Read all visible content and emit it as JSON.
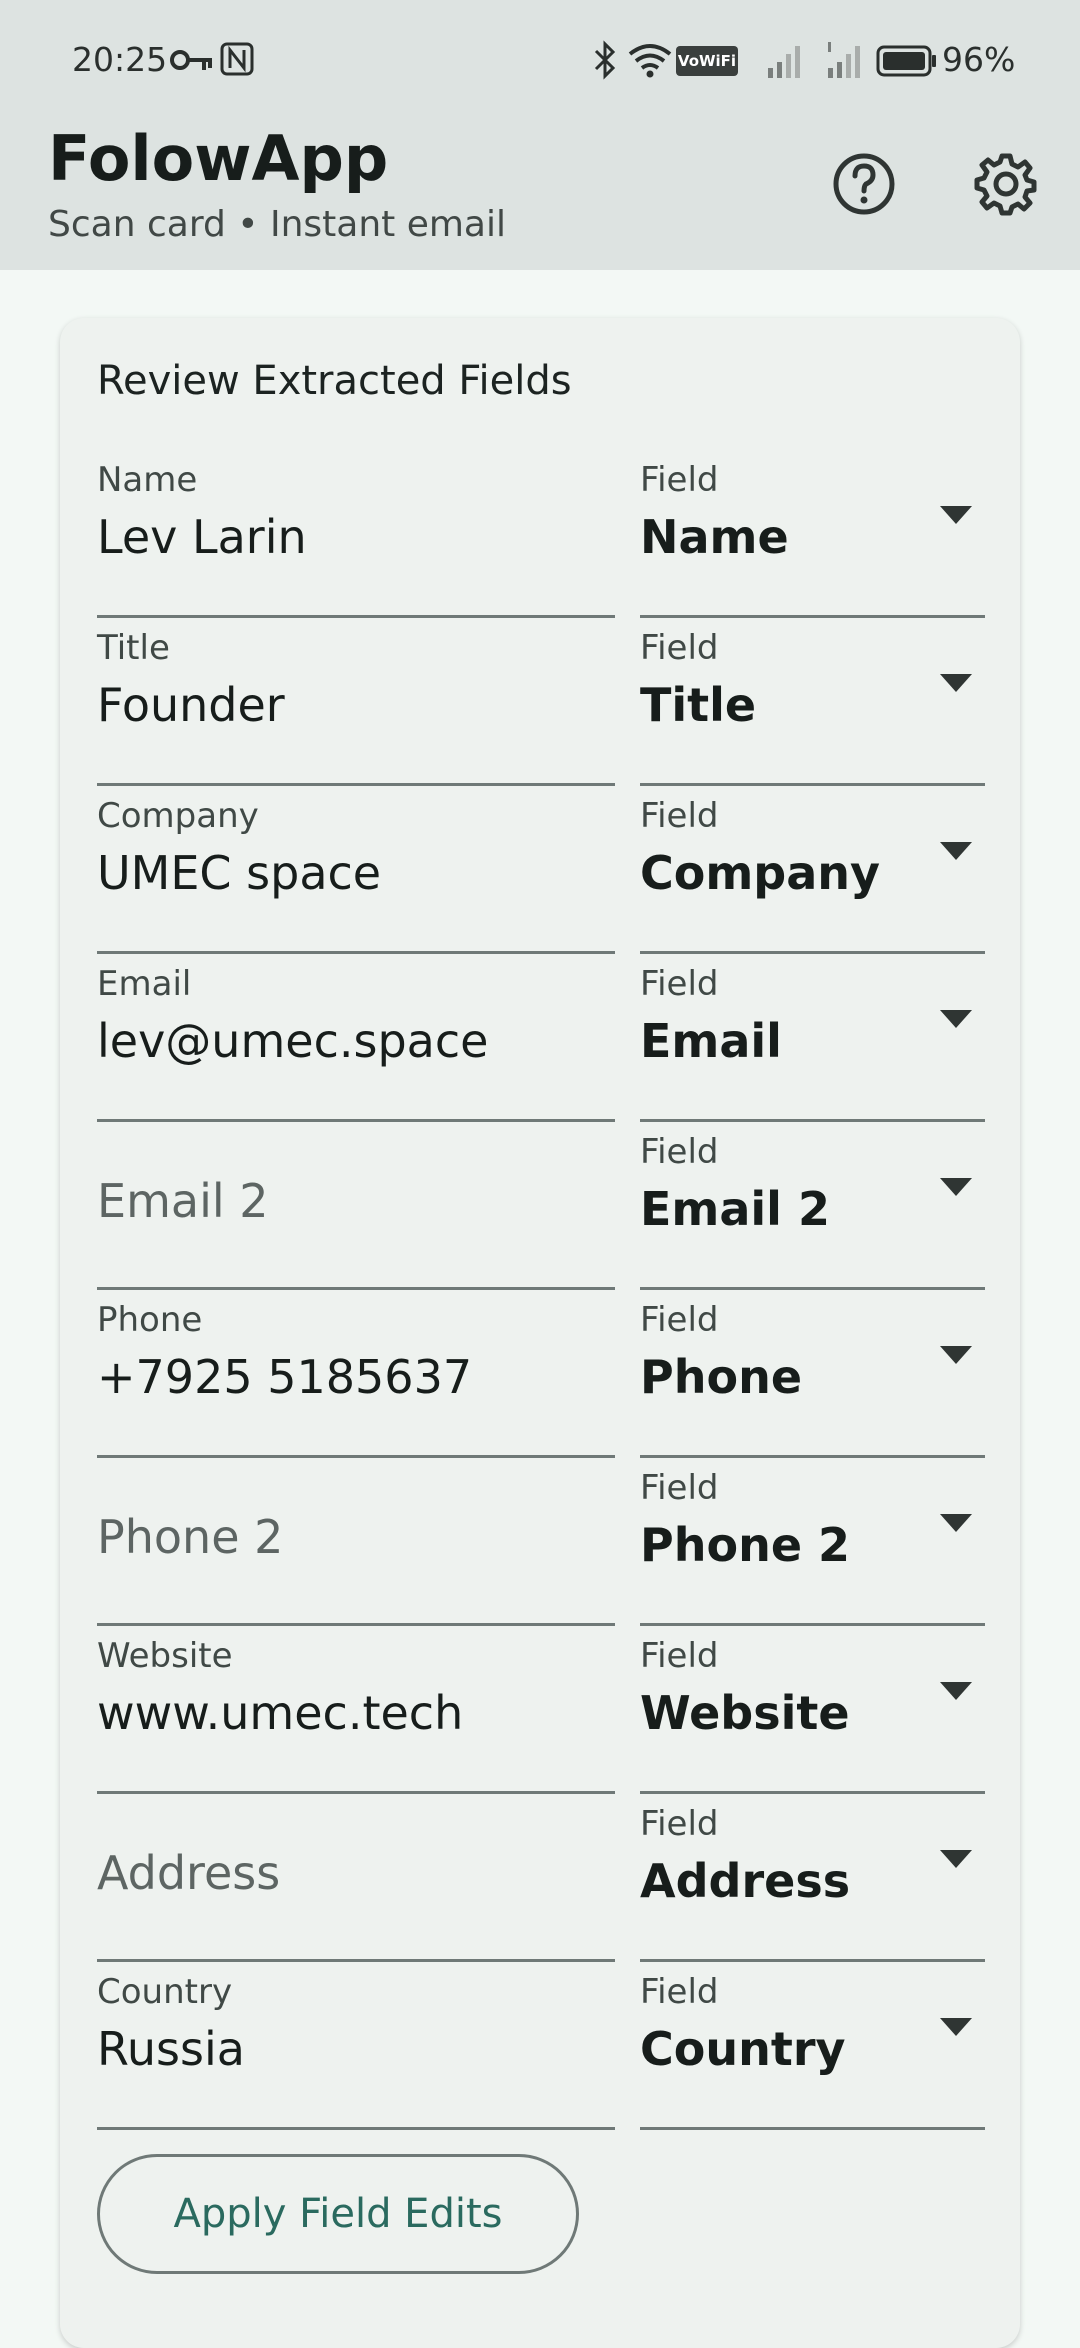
{
  "status_bar": {
    "time": "20:25",
    "vowifi": "VoWiFi",
    "battery": "96%"
  },
  "app_bar": {
    "title": "FolowApp",
    "subtitle": "Scan card • Instant email"
  },
  "card": {
    "title": "Review Extracted Fields",
    "rows": [
      {
        "label": "Name",
        "value": "Lev Larin",
        "placeholder": "",
        "field_label": "Field",
        "field_value": "Name"
      },
      {
        "label": "Title",
        "value": "Founder",
        "placeholder": "",
        "field_label": "Field",
        "field_value": "Title"
      },
      {
        "label": "Company",
        "value": "UMEC space",
        "placeholder": "",
        "field_label": "Field",
        "field_value": "Company"
      },
      {
        "label": "Email",
        "value": "lev@umec.space",
        "placeholder": "",
        "field_label": "Field",
        "field_value": "Email"
      },
      {
        "label": "",
        "value": "",
        "placeholder": "Email 2",
        "field_label": "Field",
        "field_value": "Email 2"
      },
      {
        "label": "Phone",
        "value": "+7925 5185637",
        "placeholder": "",
        "field_label": "Field",
        "field_value": "Phone"
      },
      {
        "label": "",
        "value": "",
        "placeholder": "Phone 2",
        "field_label": "Field",
        "field_value": "Phone 2"
      },
      {
        "label": "Website",
        "value": "www.umec.tech",
        "placeholder": "",
        "field_label": "Field",
        "field_value": "Website"
      },
      {
        "label": "",
        "value": "",
        "placeholder": "Address",
        "field_label": "Field",
        "field_value": "Address"
      },
      {
        "label": "Country",
        "value": "Russia",
        "placeholder": "",
        "field_label": "Field",
        "field_value": "Country"
      }
    ],
    "apply_button": "Apply Field Edits"
  },
  "colors": {
    "app_bar_bg": "#dde3e1",
    "page_bg": "#f3f8f5",
    "card_bg": "#eef2ef",
    "accent": "#2a6a5f"
  },
  "icons": [
    "key-icon",
    "nfc-icon",
    "bluetooth-icon",
    "wifi-icon",
    "signal-icon",
    "battery-icon",
    "help-icon",
    "gear-icon",
    "chevron-down-icon"
  ]
}
